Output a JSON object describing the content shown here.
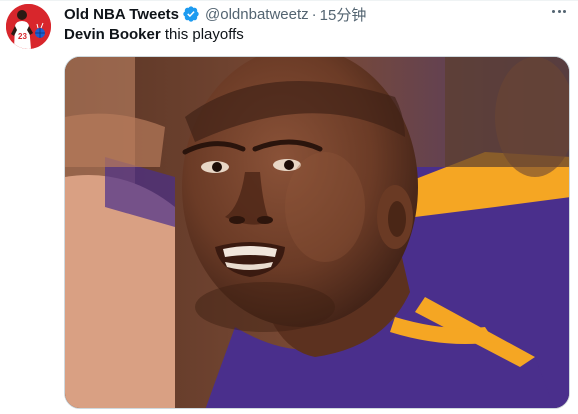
{
  "author": {
    "display_name": "Old NBA Tweets",
    "handle": "@oldnbatweetz",
    "separator": "·",
    "timestamp": "15分钟",
    "verified": true,
    "avatar_jersey_number": "23"
  },
  "tweet": {
    "mention": "Devin Booker",
    "text": " this playoffs"
  },
  "media": {
    "icon": "photo-player-reaction"
  },
  "colors": {
    "verified_blue": "#1d9bf0",
    "avatar_red": "#d8262c",
    "secondary_text": "#536471",
    "lakers_purple": "#4a2f8c",
    "lakers_gold": "#f5a623"
  }
}
